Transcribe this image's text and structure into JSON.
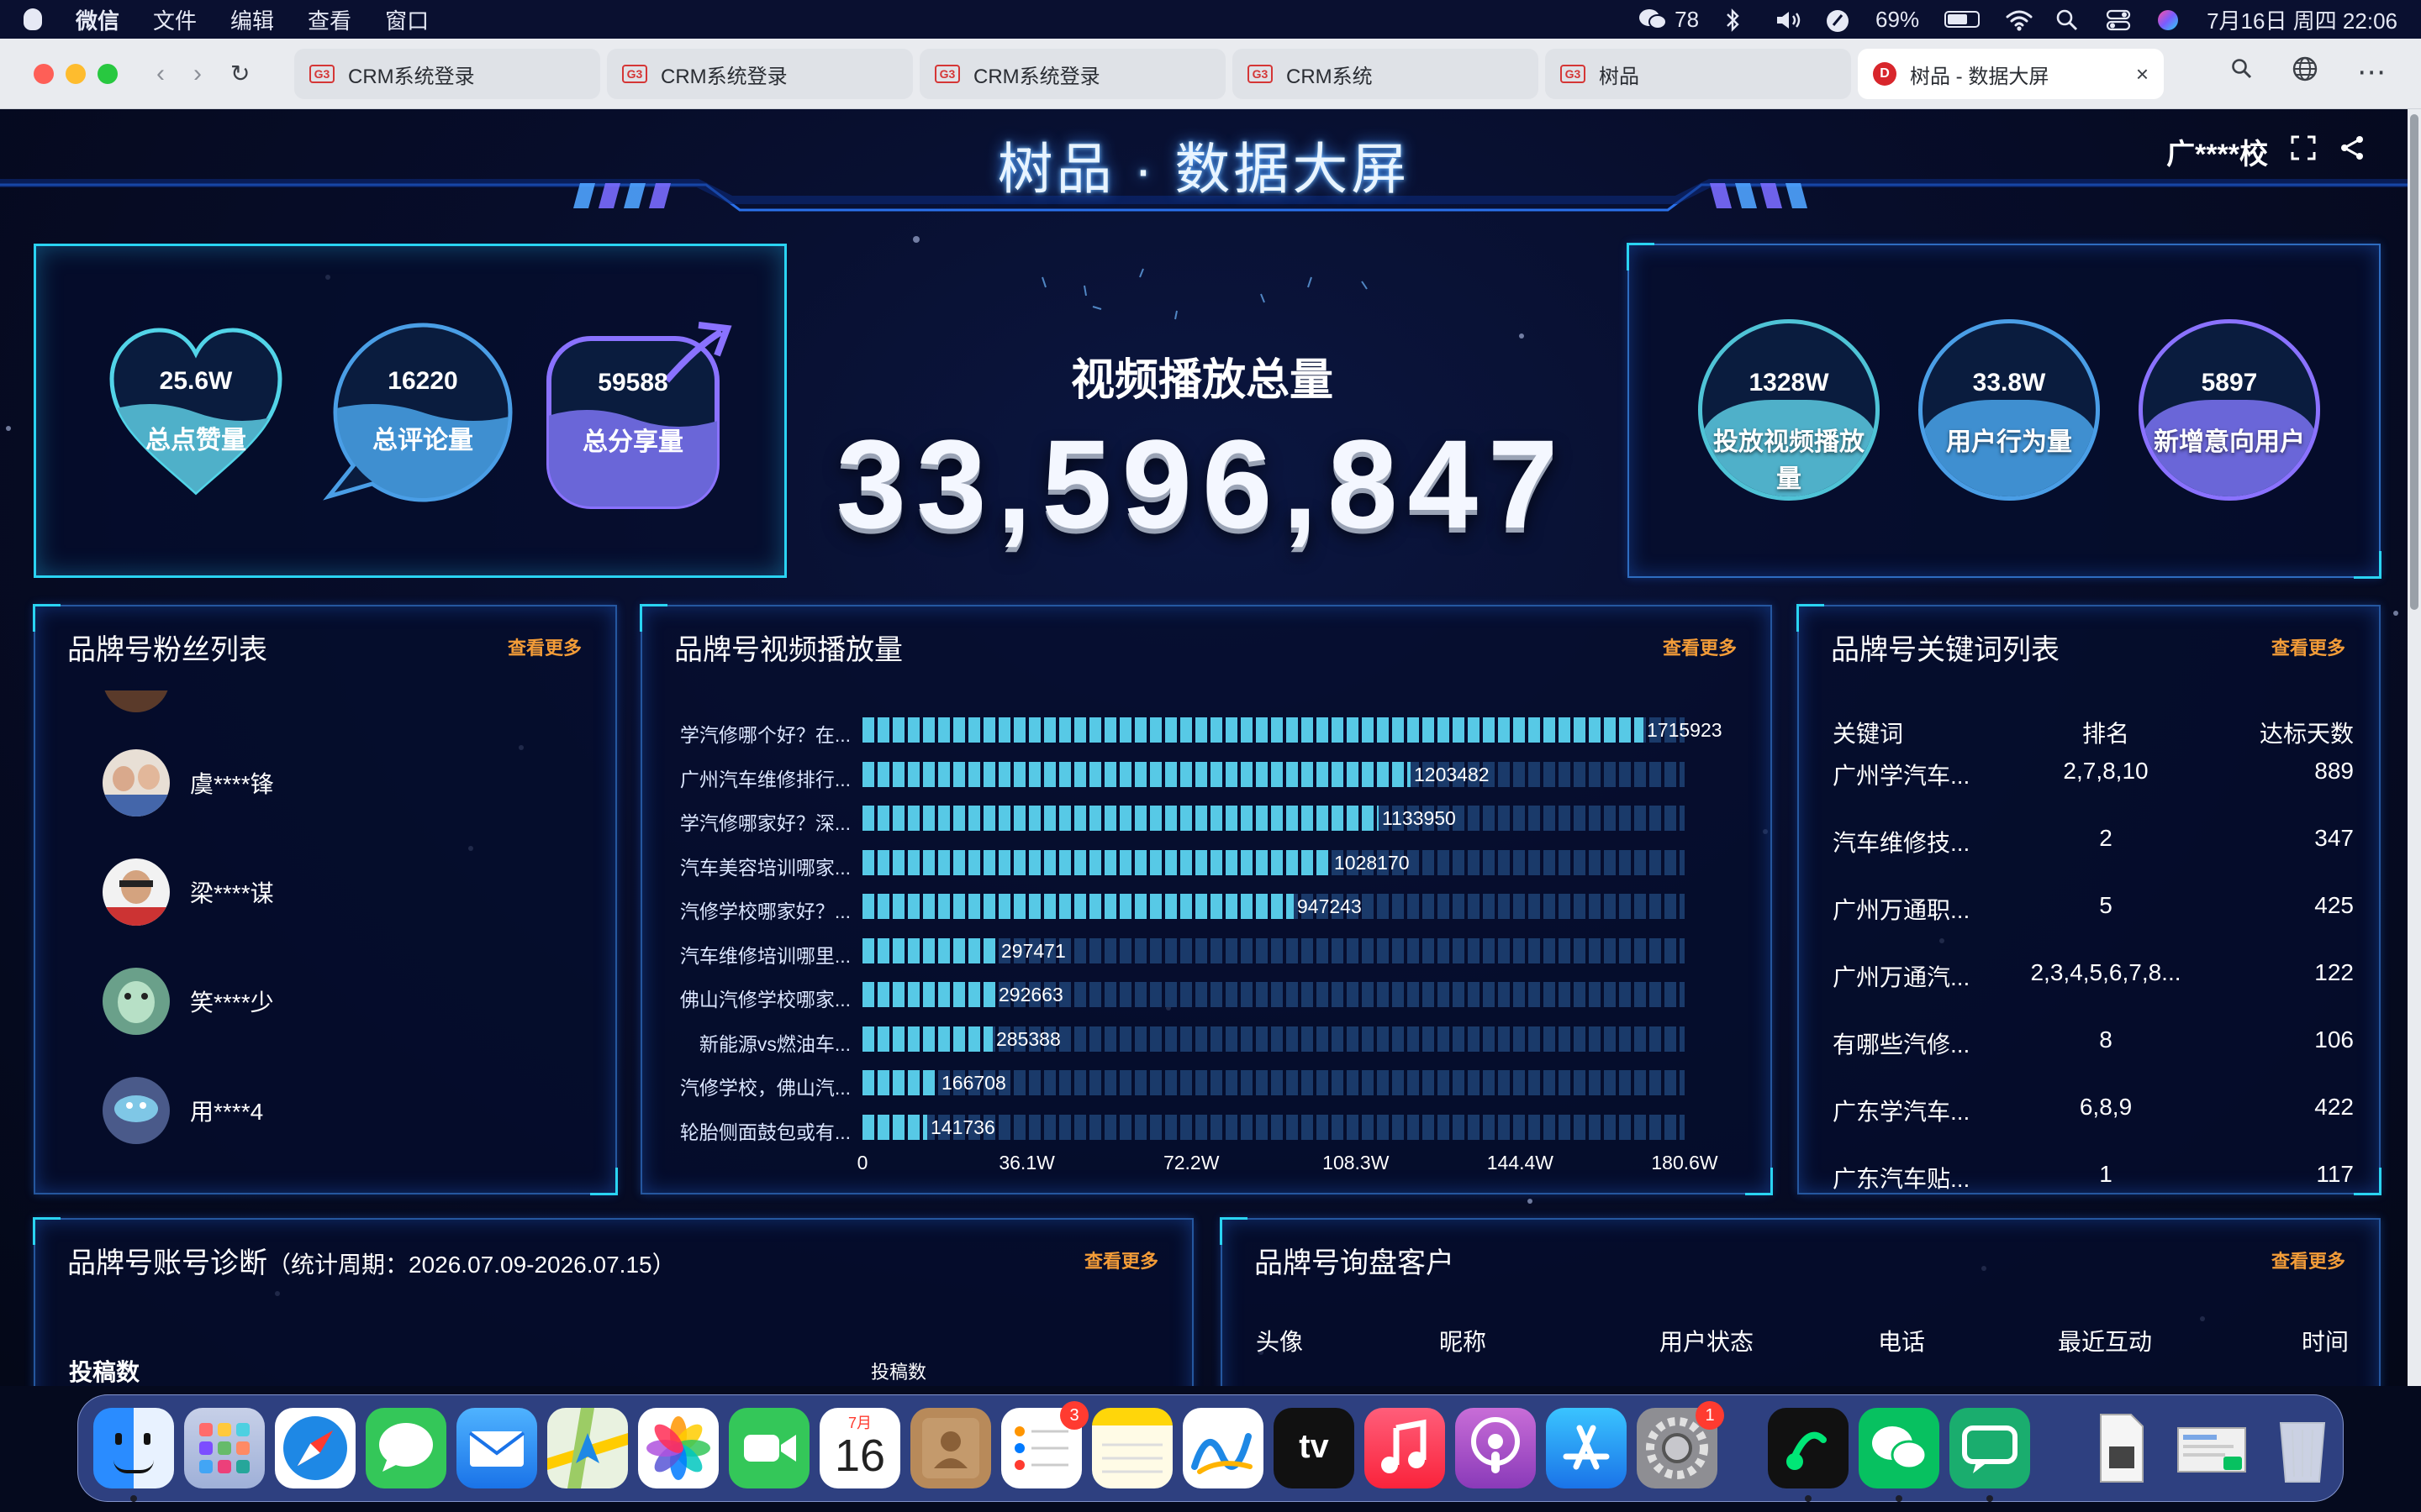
{
  "menubar": {
    "app": "微信",
    "menus": [
      "文件",
      "编辑",
      "查看",
      "窗口"
    ],
    "wechat_count": "78",
    "battery": "69%",
    "battery_level": 0.69,
    "datetime": "7月16日 周四 22:06"
  },
  "browser": {
    "tabs": [
      {
        "label": "CRM系统登录"
      },
      {
        "label": "CRM系统登录"
      },
      {
        "label": "CRM系统登录"
      },
      {
        "label": "CRM系统"
      },
      {
        "label": "树品"
      },
      {
        "label": "树品 - 数据大屏"
      }
    ],
    "favicon_text": "G3",
    "active_favicon_text": "D"
  },
  "dashboard": {
    "title": "树品 · 数据大屏",
    "account": "广****校",
    "left_stats": [
      {
        "value": "25.6W",
        "label": "总点赞量"
      },
      {
        "value": "16220",
        "label": "总评论量"
      },
      {
        "value": "59588",
        "label": "总分享量"
      }
    ],
    "center_label": "视频播放总量",
    "center_value": "33,596,847",
    "right_stats": [
      {
        "value": "1328W",
        "label": "投放视频播放量"
      },
      {
        "value": "33.8W",
        "label": "用户行为量"
      },
      {
        "value": "5897",
        "label": "新增意向用户"
      }
    ],
    "more": "查看更多",
    "fans": {
      "title": "品牌号粉丝列表",
      "items": [
        {
          "name": "虞****锋"
        },
        {
          "name": "梁****谋"
        },
        {
          "name": "笑****少"
        },
        {
          "name": "用****4"
        }
      ]
    },
    "plays": {
      "title": "品牌号视频播放量"
    },
    "keywords": {
      "title": "品牌号关键词列表",
      "headers": [
        "关键词",
        "排名",
        "达标天数"
      ],
      "rows": [
        [
          "广州学汽车...",
          "2,7,8,10",
          "889"
        ],
        [
          "汽车维修技...",
          "2",
          "347"
        ],
        [
          "广州万通职...",
          "5",
          "425"
        ],
        [
          "广州万通汽...",
          "2,3,4,5,6,7,8...",
          "122"
        ],
        [
          "有哪些汽修...",
          "8",
          "106"
        ],
        [
          "广东学汽车...",
          "6,8,9",
          "422"
        ],
        [
          "广东汽车贴...",
          "1",
          "117"
        ]
      ]
    },
    "diagnosis": {
      "title": "品牌号账号诊断",
      "period": "（统计周期：2026.07.09-2026.07.15）",
      "label_left": "投稿数",
      "label_right": "投稿数"
    },
    "inquiry": {
      "title": "品牌号询盘客户",
      "headers": [
        "头像",
        "昵称",
        "用户状态",
        "电话",
        "最近互动",
        "时间"
      ]
    }
  },
  "chart_data": {
    "type": "bar",
    "orientation": "horizontal",
    "categories": [
      "学汽修哪个好？在...",
      "广州汽车维修排行...",
      "学汽修哪家好？深...",
      "汽车美容培训哪家...",
      "汽修学校哪家好？...",
      "汽车维修培训哪里...",
      "佛山汽修学校哪家...",
      "新能源vs燃油车...",
      "汽修学校，佛山汽...",
      "轮胎侧面鼓包或有..."
    ],
    "values": [
      1715923,
      1203482,
      1133950,
      1028170,
      947243,
      297471,
      292663,
      285388,
      166708,
      141736
    ],
    "xlim": [
      0,
      1806000
    ],
    "xticks": [
      "0",
      "36.1W",
      "72.2W",
      "108.3W",
      "144.4W",
      "180.6W"
    ],
    "bar_color": "#57c9e6",
    "track_color": "#1a3a6a"
  },
  "dock": {
    "calendar_month": "7月",
    "calendar_day": "16",
    "reminders_badge": "3",
    "settings_badge": "1",
    "tv_label": "tv"
  }
}
